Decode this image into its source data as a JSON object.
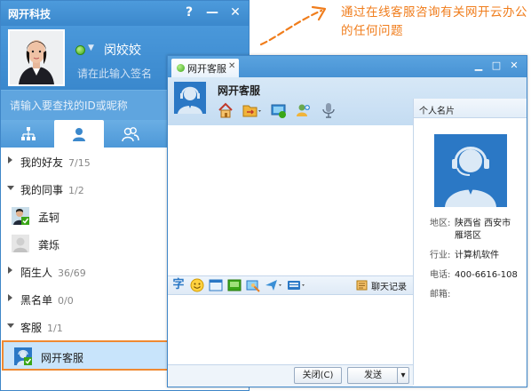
{
  "main_window": {
    "title": "网开科技",
    "controls": {
      "help": "?",
      "minimize": "—",
      "close": "✕"
    },
    "user": {
      "name": "闵姣姣",
      "signature_placeholder": "请在此输入签名",
      "status": "online"
    },
    "search_placeholder": "请输入要查找的ID或昵称",
    "tabs": [
      {
        "id": "org",
        "icon": "org-chart-icon",
        "active": false
      },
      {
        "id": "contacts",
        "icon": "person-icon",
        "active": true
      },
      {
        "id": "groups",
        "icon": "people-icon",
        "active": false
      }
    ],
    "groups": {
      "friends": {
        "name": "我的好友",
        "count": "7/15",
        "expanded": false
      },
      "colleagues": {
        "name": "我的同事",
        "count": "1/2",
        "expanded": true,
        "members": [
          "孟轲",
          "龚烁"
        ]
      },
      "strangers": {
        "name": "陌生人",
        "count": "36/69",
        "expanded": false
      },
      "blacklist": {
        "name": "黑名单",
        "count": "0/0",
        "expanded": false
      },
      "support": {
        "name": "客服",
        "count": "1/1",
        "expanded": true,
        "members": [
          "网开客服"
        ]
      }
    }
  },
  "chat_window": {
    "tab_label": "网开客服",
    "tab_close": "✕",
    "controls": {
      "restore": "▁",
      "maximize": "□",
      "close": "✕"
    },
    "contact_name": "网开客服",
    "toolbar_icons": [
      "home-icon",
      "folder-transfer-icon",
      "screen-share-icon",
      "add-contact-icon",
      "voice-icon"
    ],
    "input_tools": [
      "font-icon",
      "emoji-icon",
      "window-icon",
      "picture-icon",
      "screenshot-icon",
      "send-file-icon",
      "keyboard-icon"
    ],
    "font_tool_glyph": "字",
    "history_label": "聊天记录",
    "close_label": "关闭(C)",
    "send_label": "发送",
    "send_options": "▾",
    "side_panel": {
      "title": "个人名片",
      "region_label": "地区:",
      "region_value": "陕西省 西安市 雁塔区",
      "industry_label": "行业:",
      "industry_value": "计算机软件",
      "phone_label": "电话:",
      "phone_value": "400-6616-108",
      "email_label": "邮箱:",
      "email_value": ""
    }
  },
  "annotation": {
    "text": "通过在线客服咨询有关网开云办公的任何问题",
    "color": "#f07d1c"
  },
  "colors": {
    "titlebar": "#3b88cc",
    "selected_row_border": "#f08a32",
    "selected_row_fill": "#c8e4fb"
  }
}
